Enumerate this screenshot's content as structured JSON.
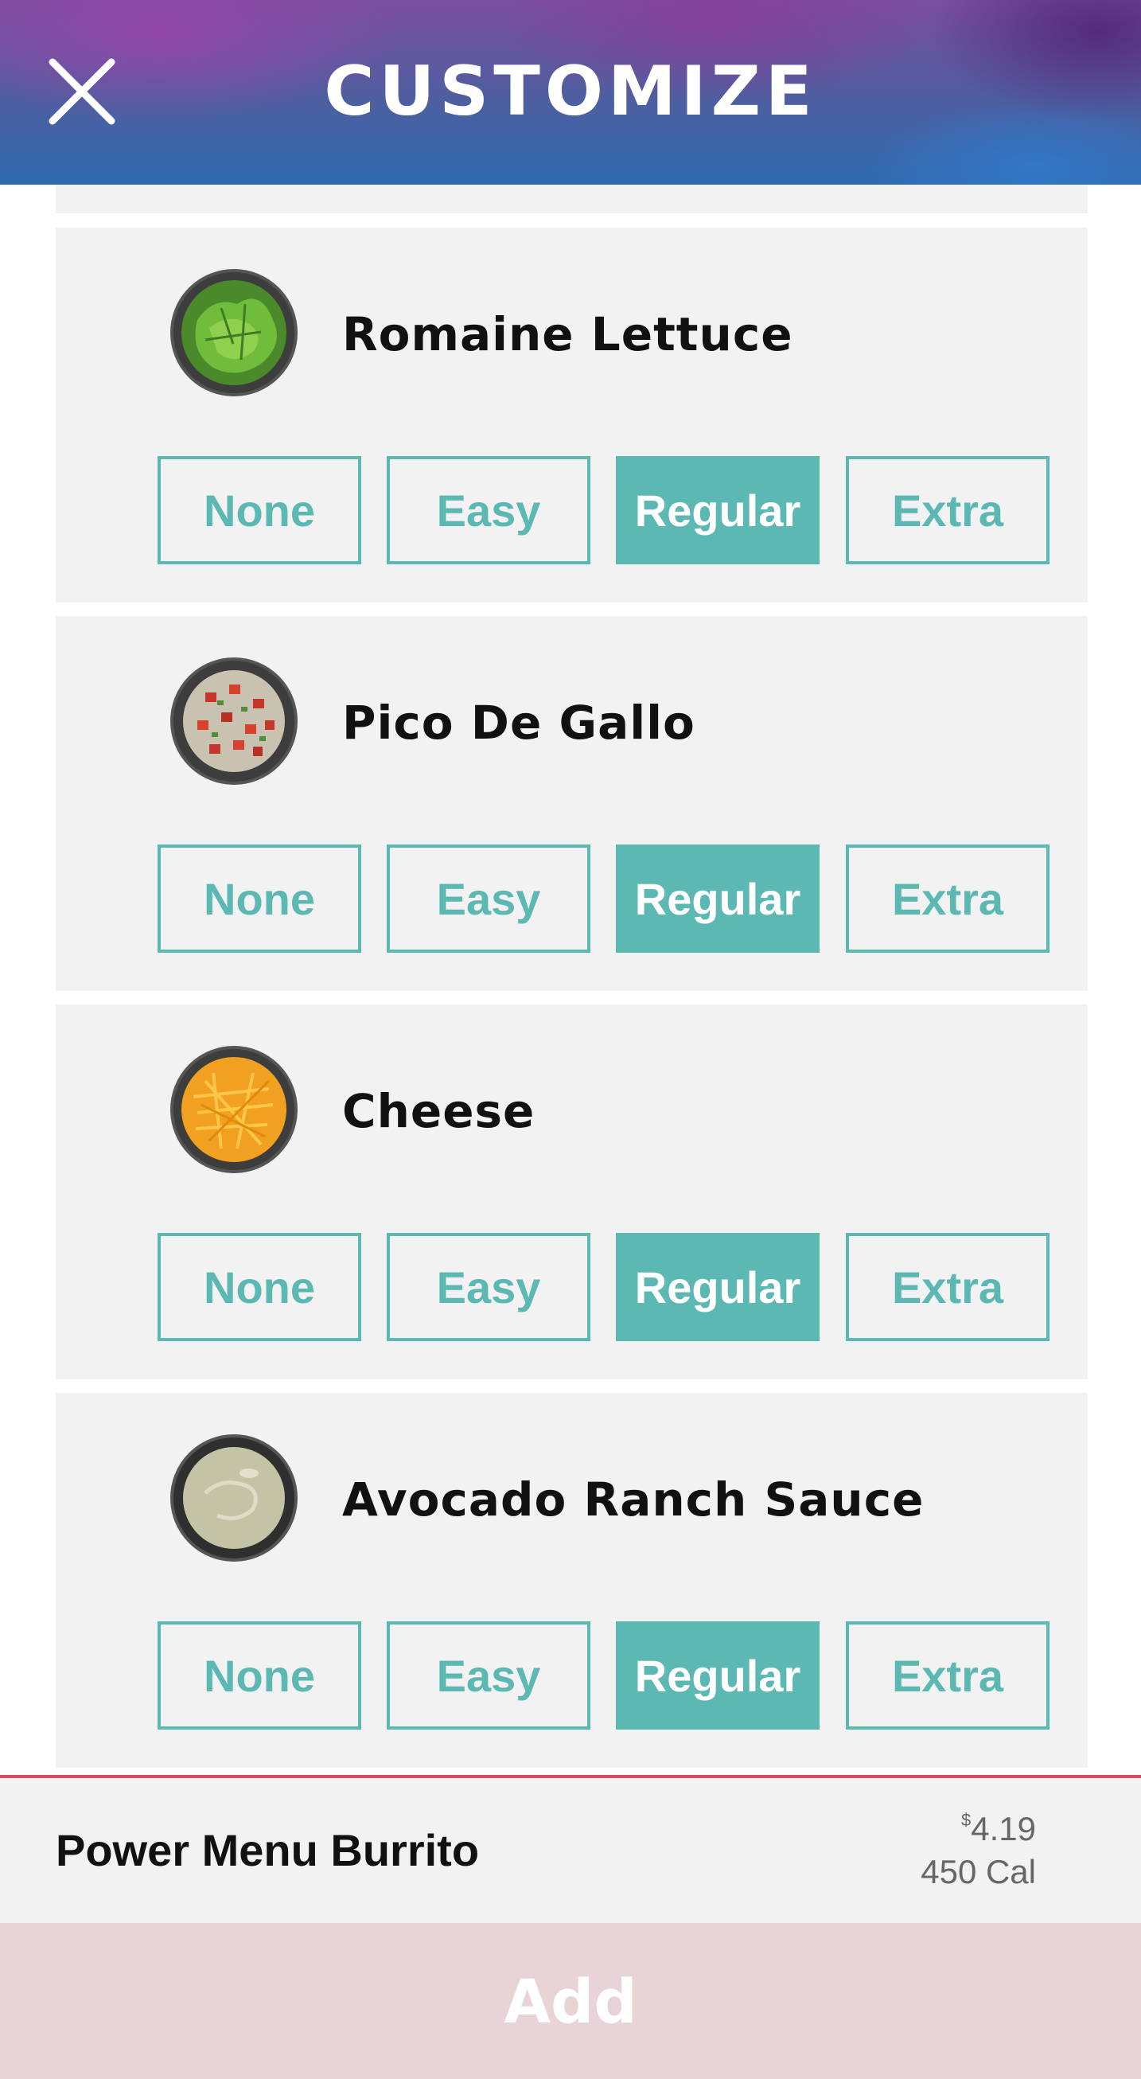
{
  "header": {
    "title": "CUSTOMIZE",
    "close_icon": "close-icon"
  },
  "options_labels": [
    "None",
    "Easy",
    "Regular",
    "Extra"
  ],
  "items": [
    {
      "name": "Romaine Lettuce",
      "image": "romaine-lettuce-bowl",
      "selected": "Regular"
    },
    {
      "name": "Pico De Gallo",
      "image": "pico-de-gallo-bowl",
      "selected": "Regular"
    },
    {
      "name": "Cheese",
      "image": "shredded-cheese-bowl",
      "selected": "Regular"
    },
    {
      "name": "Avocado Ranch Sauce",
      "image": "avocado-ranch-sauce-bowl",
      "selected": "Regular"
    }
  ],
  "summary": {
    "product_name": "Power Menu Burrito",
    "currency_symbol": "$",
    "price": "4.19",
    "calories": "450 Cal"
  },
  "add_button": {
    "label": "Add"
  },
  "colors": {
    "accent_teal": "#5cb8b2",
    "divider_red": "#d64b5e",
    "add_button_bg": "#e8d4d7",
    "card_bg": "#f2f2f2"
  }
}
